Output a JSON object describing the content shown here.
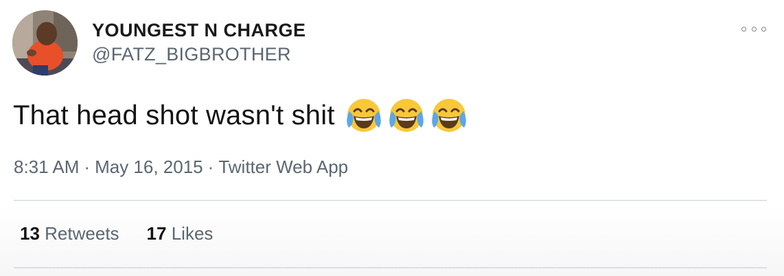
{
  "user": {
    "display_name": "YOUNGEST N CHARGE",
    "handle": "@FATZ_BIGBROTHER"
  },
  "tweet": {
    "text": "That head shot wasn't shit",
    "emojis": [
      "face-with-tears-of-joy",
      "face-with-tears-of-joy",
      "face-with-tears-of-joy"
    ],
    "time": "8:31 AM",
    "date": "May 16, 2015",
    "source": "Twitter Web App",
    "separator": "·"
  },
  "stats": {
    "retweets_count": "13",
    "retweets_label": "Retweets",
    "likes_count": "17",
    "likes_label": "Likes"
  },
  "icons": {
    "more": "more-options-icon",
    "emoji": "face-with-tears-of-joy"
  },
  "colors": {
    "name": "#1a1a1a",
    "secondary": "#5b6670",
    "divider": "#e2e4e6",
    "emoji_face": "#f8c839",
    "emoji_tears": "#5aa7ee"
  }
}
